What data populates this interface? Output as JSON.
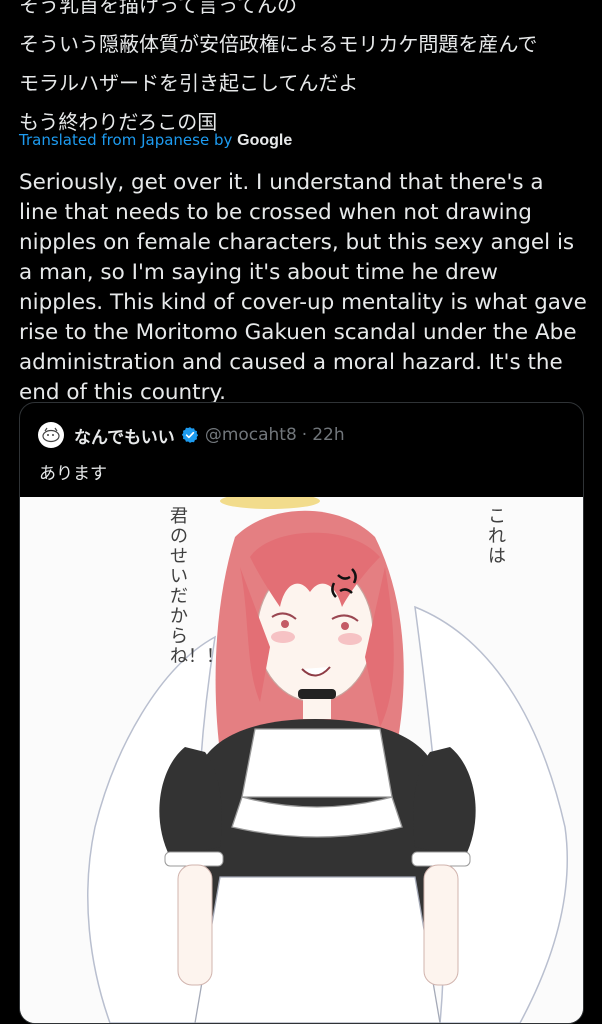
{
  "post": {
    "jp_lines": [
      "そう乳首を描けって言ってんの",
      "そういう隠蔽体質が安倍政権によるモリカケ問題を産んで",
      "モラルハザードを引き起こしてんだよ",
      "もう終わりだろこの国"
    ],
    "translated_label": "Translated from Japanese by",
    "translated_brand": "Google",
    "english_text": "Seriously, get over it. I understand that there's a line that needs to be crossed when not drawing nipples on female characters, but this sexy angel is a man, so I'm saying it's about time he drew nipples. This kind of cover-up mentality is what gave rise to the Moritomo Gakuen scandal under the Abe administration and caused a moral hazard. It's the end of this country."
  },
  "quote": {
    "display_name": "なんでもいい",
    "verified_icon": "verified-badge-icon",
    "handle": "@mocaht8",
    "separator": "·",
    "time": "22h",
    "text": "あります",
    "image": {
      "left_caption": "君のせいだからね！！",
      "right_caption": "これは"
    }
  },
  "colors": {
    "background": "#000000",
    "text": "#e7e9ea",
    "link": "#1d9bf0",
    "muted": "#71767b",
    "verified": "#1d9bf0"
  }
}
